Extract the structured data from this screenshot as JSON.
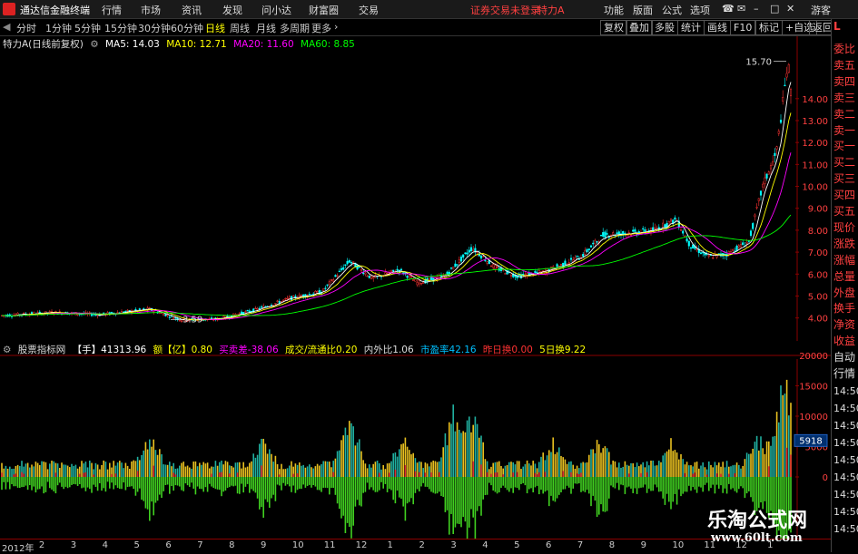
{
  "window": {
    "app_title": "通达信金融终端",
    "menu": [
      "行情",
      "市场",
      "资讯",
      "发现",
      "问小达",
      "财富圈",
      "交易"
    ],
    "warning": "证券交易未登录",
    "stock_name": "特力A",
    "right_menu": [
      "功能",
      "版面",
      "公式",
      "选项"
    ],
    "guest": "游客"
  },
  "periods": {
    "items": [
      "分时",
      "1分钟",
      "5分钟",
      "15分钟",
      "30分钟",
      "60分钟",
      "日线",
      "周线",
      "月线",
      "多周期",
      "更多"
    ],
    "active": "日线",
    "tools": [
      "复权",
      "叠加",
      "多股",
      "统计",
      "画线",
      "F10",
      "标记",
      "+自选",
      "返回"
    ]
  },
  "ma_legend": {
    "title": "特力A(日线前复权)",
    "ma5": "MA5: 14.03",
    "ma10": "MA10: 12.71",
    "ma20": "MA20: 11.60",
    "ma60": "MA60: 8.85"
  },
  "price_axis": {
    "ticks": [
      "14.00",
      "13.00",
      "12.00",
      "11.00",
      "10.00",
      "9.00",
      "8.00",
      "7.00",
      "6.00",
      "5.00",
      "4.00"
    ],
    "high_label": "15.70",
    "low_label": "3.59"
  },
  "indicator": {
    "name": "股票指标网",
    "hand_label": "【手】",
    "hand_value": "41313.96",
    "yi_label": "额【亿】",
    "yi_value": "0.80",
    "diff_label": "买卖差",
    "diff_value": "-38.06",
    "turnover_label": "成交/流通比",
    "turnover_value": "0.20",
    "inout_label": "内外比",
    "inout_value": "1.06",
    "pe_label": "市盈率",
    "pe_value": "42.16",
    "prev_label": "昨日换",
    "prev_value": "0.00",
    "five_label": "5日换",
    "five_value": "9.22",
    "current_badge": "5918"
  },
  "vol_axis": {
    "ticks": [
      "20000",
      "15000",
      "10000",
      "5000",
      "0"
    ]
  },
  "right_panel": {
    "top_label": "L",
    "labels": [
      "委比",
      "卖五",
      "卖四",
      "卖三",
      "卖二",
      "卖一",
      "买一",
      "买二",
      "买三",
      "买四",
      "买五",
      "现价",
      "涨跌",
      "涨幅",
      "总量",
      "外盘",
      "换手",
      "净资",
      "收益"
    ],
    "lower_labels": [
      "自动",
      "行情"
    ],
    "times": [
      "14:50",
      "14:50",
      "14:50",
      "14:50",
      "14:50",
      "14:50",
      "14:50",
      "14:50",
      "14:50"
    ]
  },
  "date_axis": {
    "labels": [
      "2012年",
      "2",
      "3",
      "4",
      "5",
      "6",
      "7",
      "8",
      "9",
      "10",
      "11",
      "12",
      "1",
      "2",
      "3",
      "4",
      "5",
      "6",
      "7",
      "8",
      "9",
      "10",
      "11",
      "12",
      "1"
    ]
  },
  "watermark": {
    "line1": "乐淘公式网",
    "line2": "www.60lt.com"
  },
  "colors": {
    "up": "#ff3232",
    "down": "#00ffff",
    "ma5": "#ffffff",
    "ma10": "#ffff00",
    "ma20": "#ff00ff",
    "ma60": "#00ff00",
    "vol_up": "#e8c020",
    "vol_down": "#20b0a0",
    "neg": "#40d020"
  }
}
